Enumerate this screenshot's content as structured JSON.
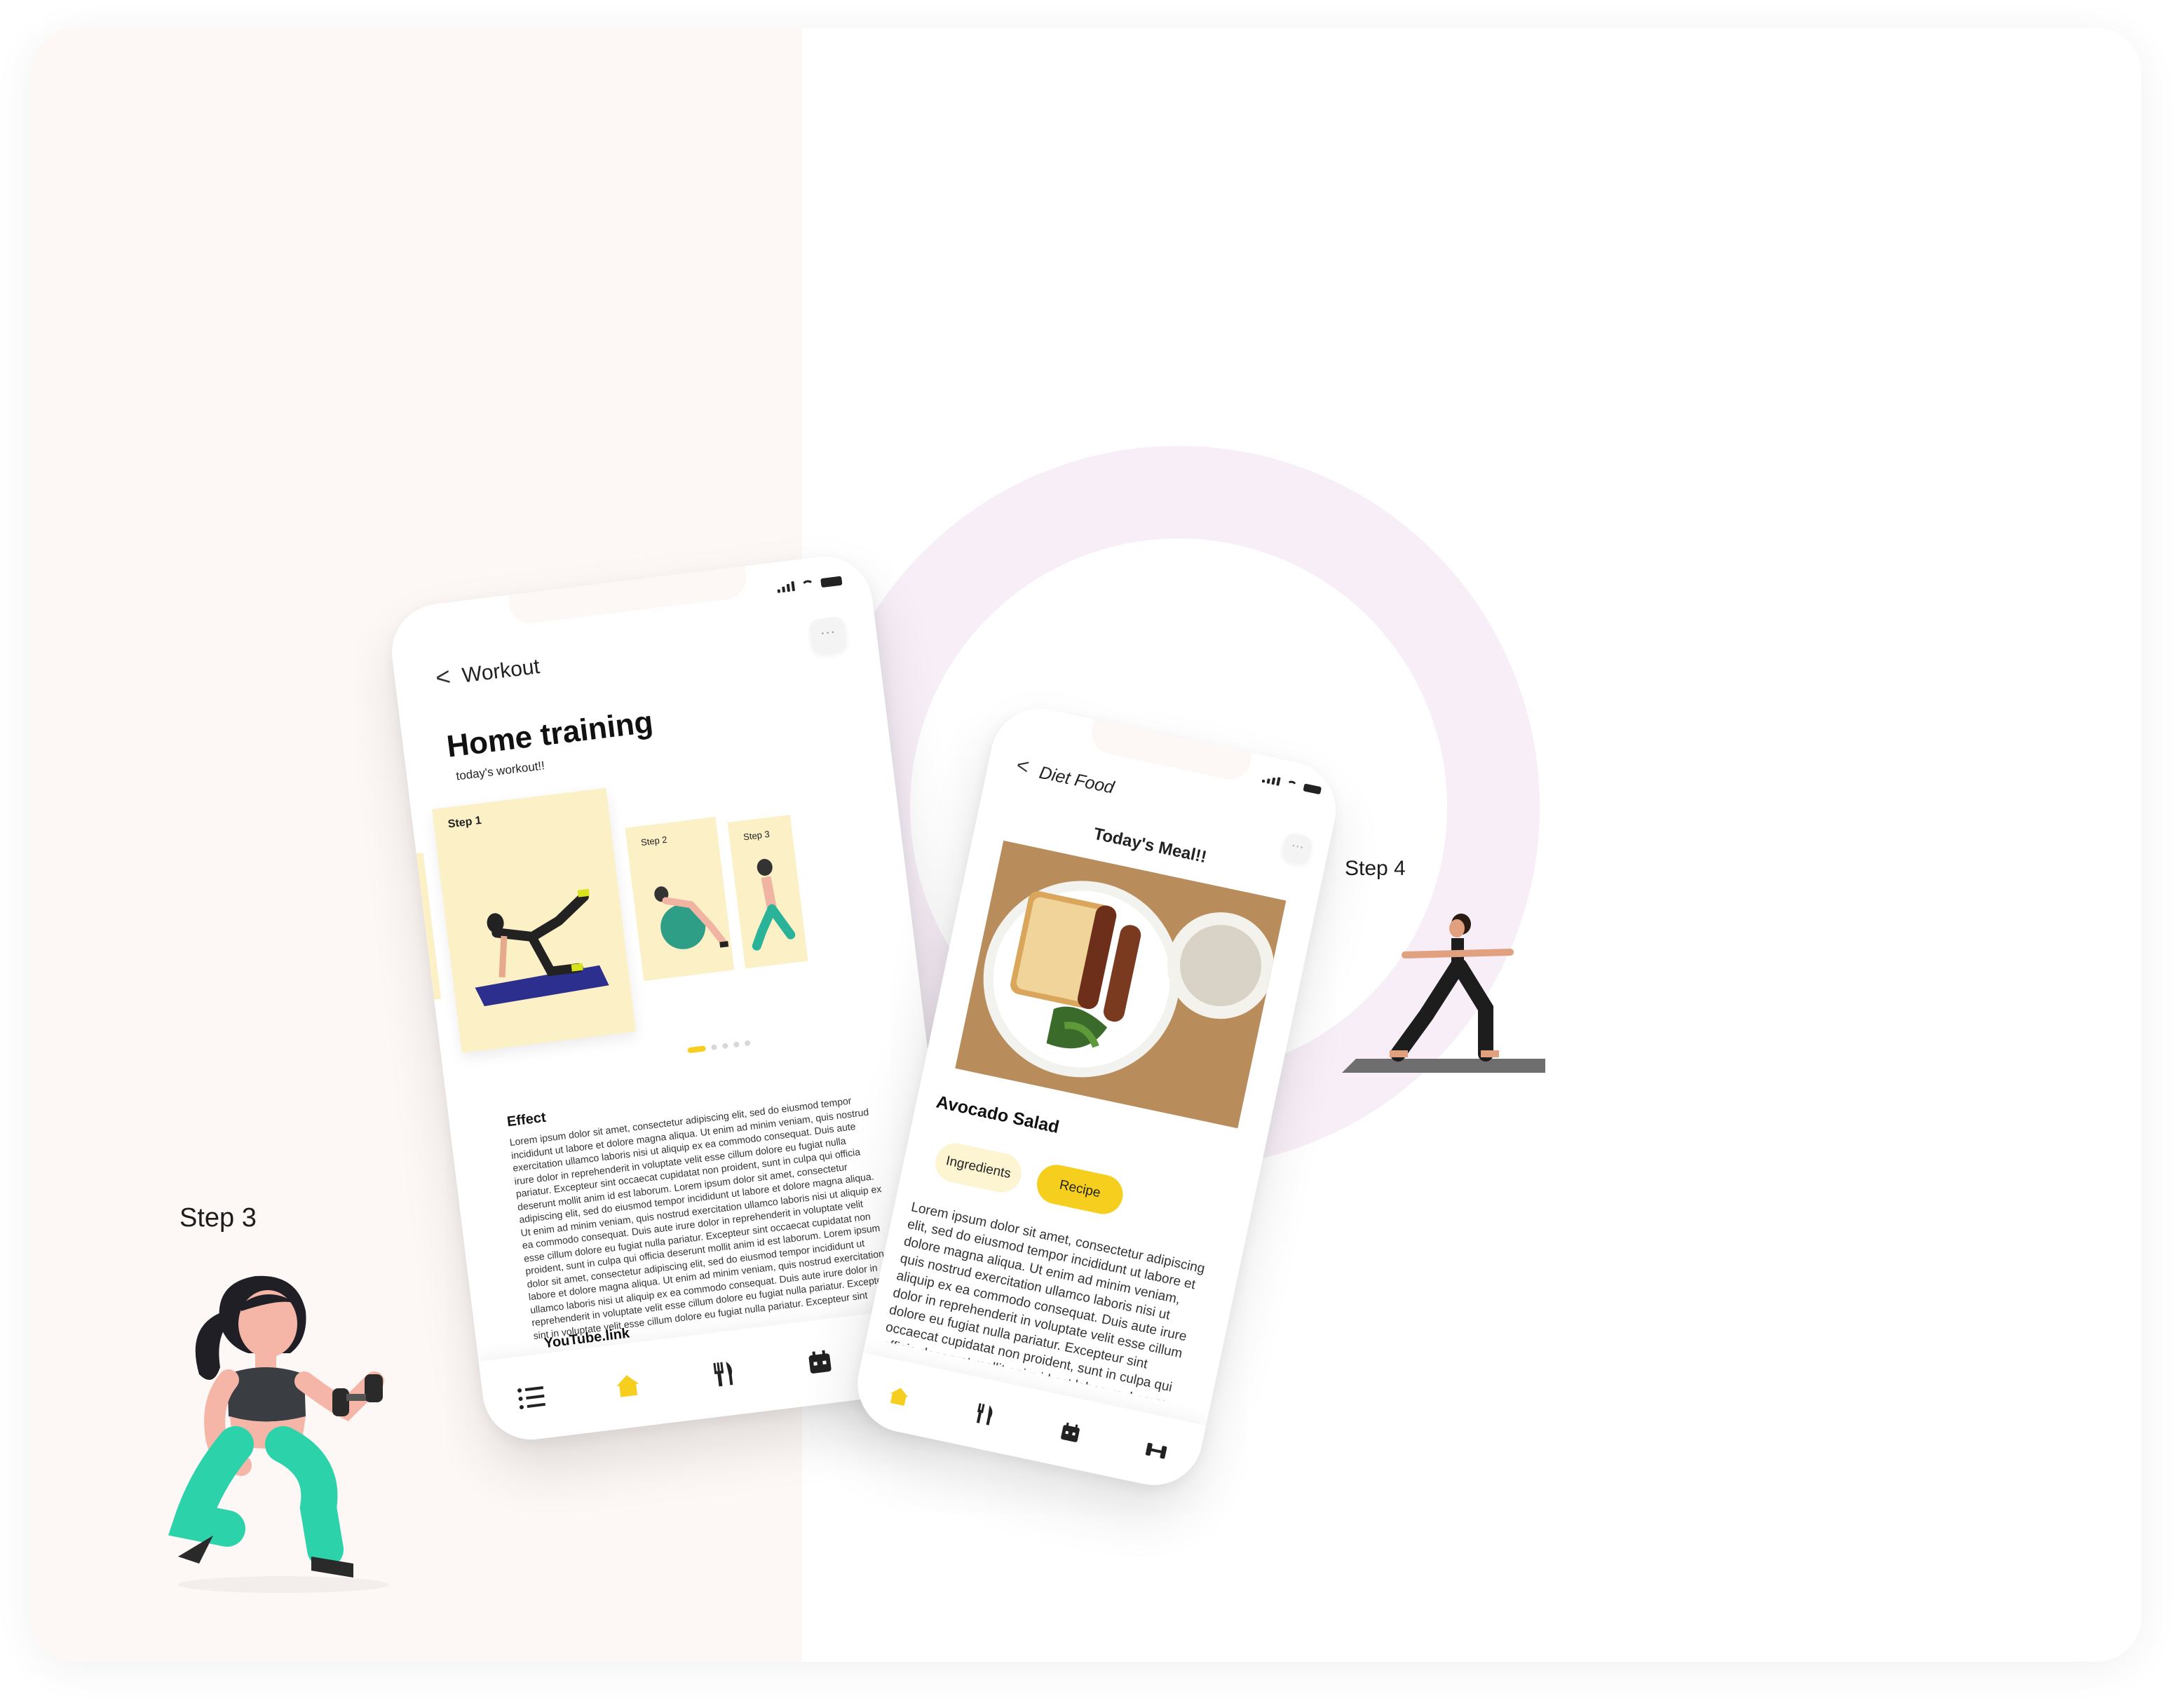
{
  "labels": {
    "step3": "Step 3",
    "step4": "Step 4"
  },
  "workout_screen": {
    "back": "<",
    "nav_title": "Workout",
    "more": "···",
    "title": "Home training",
    "subtitle": "today's workout!!",
    "cards": [
      "Step 1",
      "Step 2",
      "Step 3"
    ],
    "effect_heading": "Effect",
    "effect_text": "Lorem ipsum dolor sit amet, consectetur adipiscing elit, sed do eiusmod tempor incididunt ut labore et dolore magna aliqua. Ut enim ad minim veniam, quis nostrud exercitation ullamco laboris nisi ut aliquip ex ea commodo consequat. Duis aute irure dolor in reprehenderit in voluptate velit esse cillum dolore eu fugiat nulla pariatur. Excepteur sint occaecat cupidatat non proident, sunt in culpa qui officia deserunt mollit anim id est laborum. Lorem ipsum dolor sit amet, consectetur adipiscing elit, sed do eiusmod tempor incididunt ut labore et dolore magna aliqua. Ut enim ad minim veniam, quis nostrud exercitation ullamco laboris nisi ut aliquip ex ea commodo consequat. Duis aute irure dolor in reprehenderit in voluptate velit esse cillum dolore eu fugiat nulla pariatur. Excepteur sint occaecat cupidatat non proident, sunt in culpa qui officia deserunt mollit anim id est laborum. Lorem ipsum dolor sit amet, consectetur adipiscing elit, sed do eiusmod tempor incididunt ut labore et dolore magna aliqua. Ut enim ad minim veniam, quis nostrud exercitation ullamco laboris nisi ut aliquip ex ea commodo consequat. Duis aute irure dolor in reprehenderit in voluptate velit esse cillum dolore eu fugiat nulla pariatur. Excepteur sint in voluptate velit esse cillum dolore eu fugiat nulla pariatur. Excepteur sint",
    "link": "YouTube.link"
  },
  "diet_screen": {
    "back": "<",
    "nav_title": "Diet Food",
    "more": "···",
    "meal_title": "Today's Meal!!",
    "dish": "Avocado Salad",
    "chips": [
      "Ingredients",
      "Recipe"
    ],
    "text": "Lorem ipsum dolor sit amet, consectetur adipiscing elit, sed do eiusmod tempor incididunt ut labore et dolore magna aliqua. Ut enim ad minim veniam, quis nostrud exercitation ullamco laboris nisi ut aliquip ex ea commodo consequat. Duis aute irure dolor in reprehenderit in voluptate velit esse cillum dolore eu fugiat nulla pariatur. Excepteur sint occaecat cupidatat non proident, sunt in culpa qui officia deserunt mollit anim id est laborum. Lorem ipsum dolor sit amet, consectetur adipiscing elit, sed do"
  },
  "bottom_nav_icons": [
    "list-icon",
    "home-icon",
    "fork-knife-icon",
    "calendar-icon",
    "dumbbell-icon"
  ],
  "colors": {
    "accent": "#f6cf1e",
    "card": "#fbf0c6",
    "panel": "#fdf7f5",
    "ring": "#f7eef7"
  }
}
